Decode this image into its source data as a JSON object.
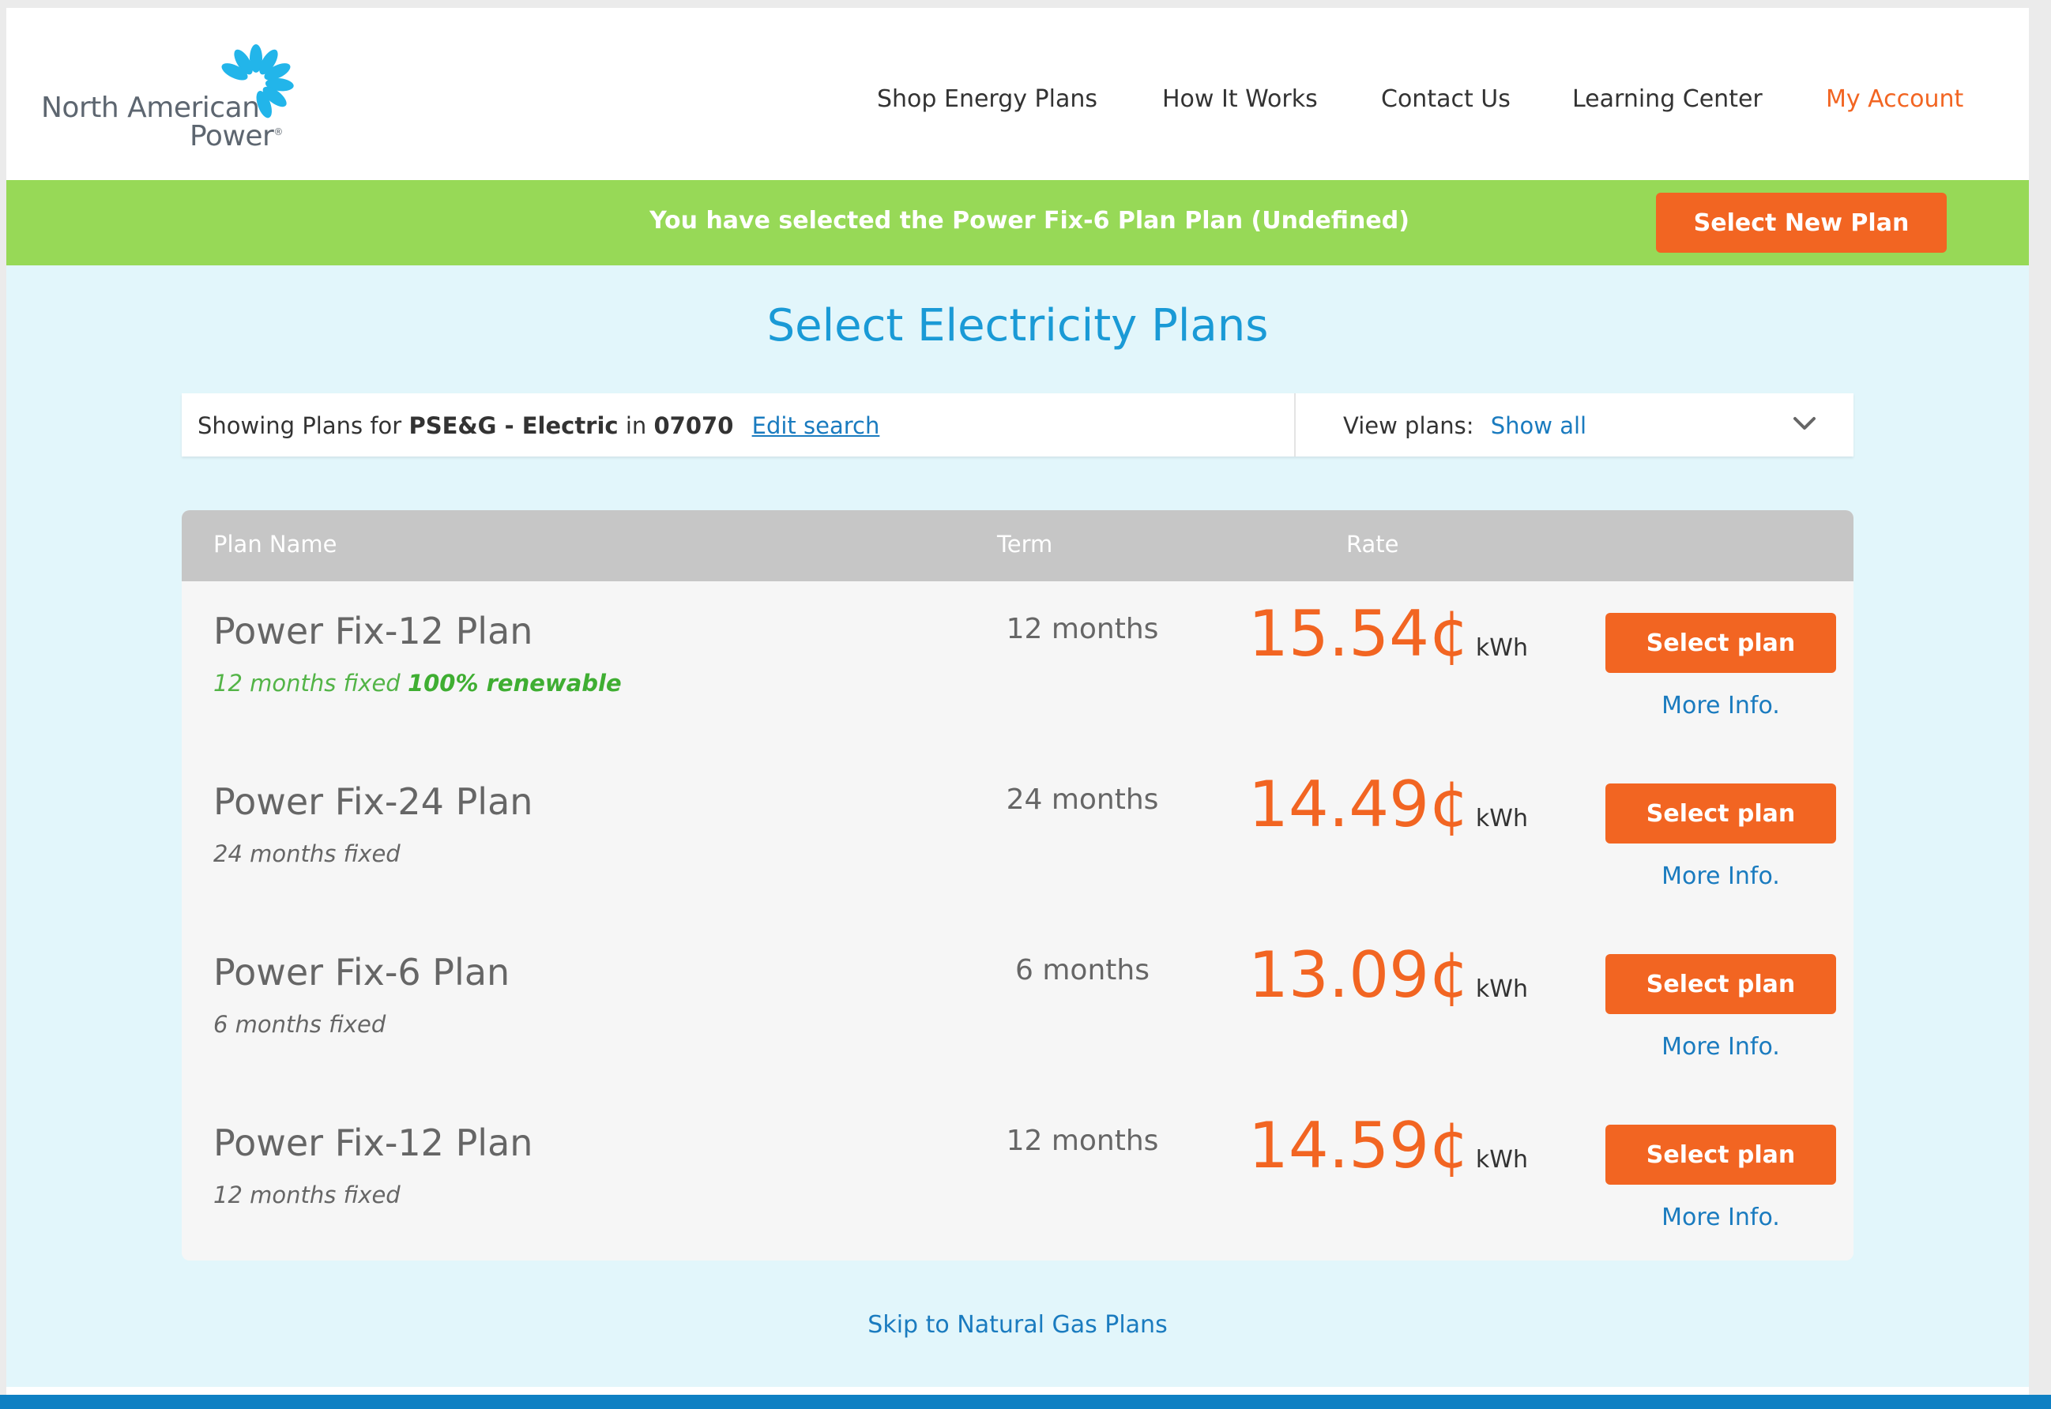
{
  "brand": {
    "logo_line1": "North American",
    "logo_line2": "Power",
    "logo_mark": "®",
    "burst_color": "#22b5ea"
  },
  "nav": {
    "items": [
      {
        "label": "Shop Energy Plans"
      },
      {
        "label": "How It Works"
      },
      {
        "label": "Contact Us"
      },
      {
        "label": "Learning Center"
      },
      {
        "label": "My Account"
      }
    ]
  },
  "banner": {
    "text": "You have selected the Power Fix-6 Plan Plan (Undefined)",
    "button_label": "Select New Plan"
  },
  "page_title": "Select Electricity Plans",
  "search": {
    "prefix": "Showing Plans for",
    "utility": "PSE&G - Electric",
    "in_word": "in",
    "zip": "07070",
    "edit_label": "Edit search",
    "view_label": "View plans:",
    "view_value": "Show all"
  },
  "table": {
    "headers": {
      "plan_name": "Plan Name",
      "term": "Term",
      "rate": "Rate"
    },
    "rows": [
      {
        "name": "Power Fix-12 Plan",
        "desc": "12 months fixed",
        "desc_bold": "100% renewable",
        "term": "12 months",
        "rate": "15.54¢",
        "unit": "kWh",
        "button": "Select plan",
        "more": "More Info."
      },
      {
        "name": "Power Fix-24 Plan",
        "desc": "24 months fixed",
        "desc_bold": "",
        "term": "24 months",
        "rate": "14.49¢",
        "unit": "kWh",
        "button": "Select plan",
        "more": "More Info."
      },
      {
        "name": "Power Fix-6 Plan",
        "desc": "6 months fixed",
        "desc_bold": "",
        "term": "6 months",
        "rate": "13.09¢",
        "unit": "kWh",
        "button": "Select plan",
        "more": "More Info."
      },
      {
        "name": "Power Fix-12 Plan",
        "desc": "12 months fixed",
        "desc_bold": "",
        "term": "12 months",
        "rate": "14.59¢",
        "unit": "kWh",
        "button": "Select plan",
        "more": "More Info."
      }
    ]
  },
  "skip_link": "Skip to Natural Gas Plans",
  "colors": {
    "accent_orange": "#f26522",
    "banner_green": "#97d957",
    "title_blue": "#1a9ad6",
    "link_blue": "#1a7bbf",
    "main_bg": "#e2f6fb"
  }
}
